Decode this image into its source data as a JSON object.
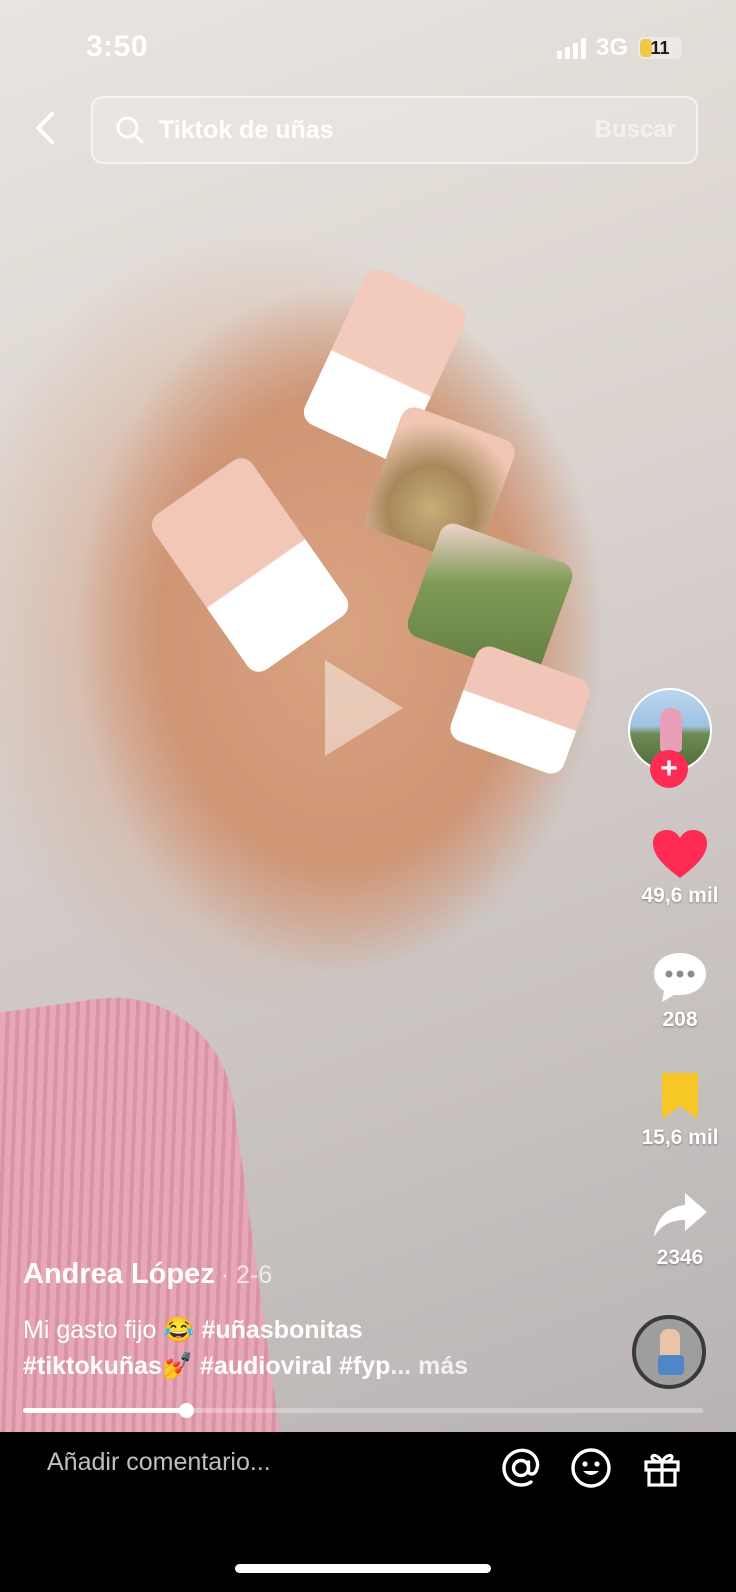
{
  "status_bar": {
    "time": "3:50",
    "network": "3G",
    "battery": "11"
  },
  "search": {
    "query": "Tiktok de uñas",
    "button_label": "Buscar"
  },
  "actions": {
    "likes": "49,6 mil",
    "comments": "208",
    "saves": "15,6 mil",
    "shares": "2346"
  },
  "post": {
    "author": "Andrea López",
    "date": "· 2-6",
    "caption_text": "Mi gasto fijo",
    "caption_emoji": "😂",
    "hashtag_1": "#uñasbonitas",
    "hashtag_2": "#tiktokuñas",
    "hashtag_2_emoji": "💅",
    "hashtag_3": "#audioviral",
    "hashtag_4": "#fyp",
    "more_label": "... más"
  },
  "playback": {
    "progress": 0.24
  },
  "comment_bar": {
    "placeholder": "Añadir comentario..."
  },
  "colors": {
    "like": "#fe2c55",
    "save": "#f7c825",
    "follow": "#fe2c55"
  }
}
